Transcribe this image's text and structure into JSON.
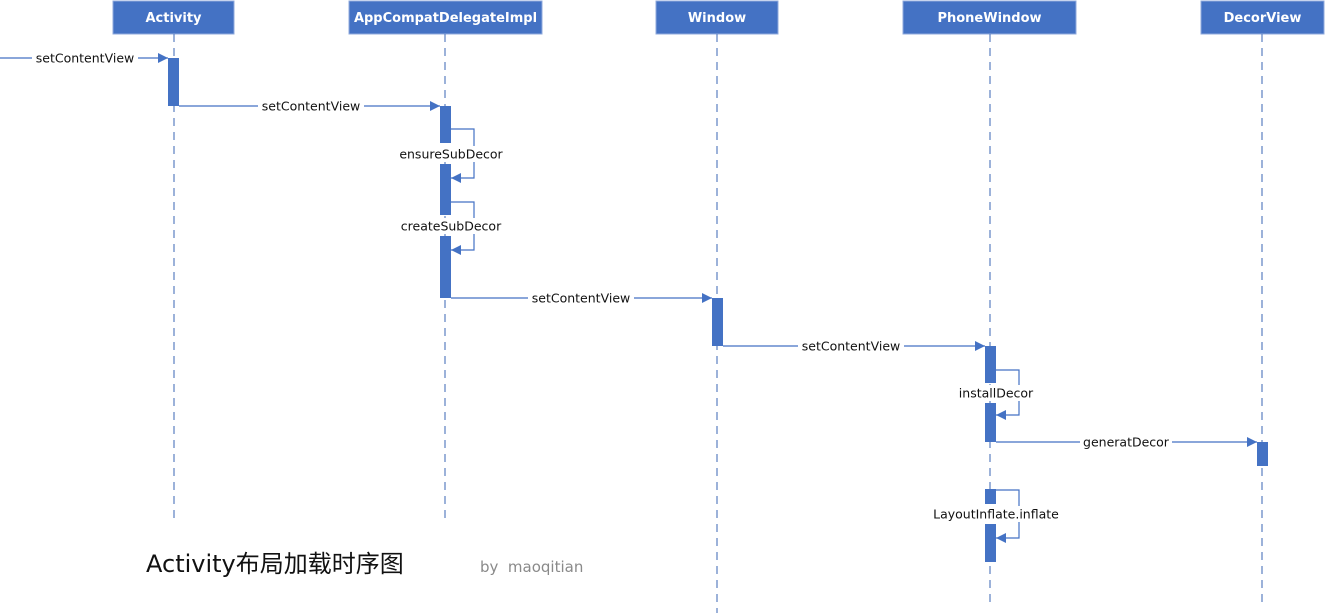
{
  "diagram": {
    "type": "sequence",
    "title": "Activity布局加载时序图",
    "author": "by  maoqitian",
    "colors": {
      "header_fill": "#4472c4",
      "header_stroke": "#8faadc",
      "activation_fill": "#4472c4",
      "message_line": "#4472c4",
      "lifeline": "#5b7fc0",
      "label_bg": "#ffffff"
    },
    "participants": [
      {
        "id": "activity",
        "label": "Activity"
      },
      {
        "id": "appcompat",
        "label": "AppCompatDelegateImpl"
      },
      {
        "id": "window",
        "label": "Window"
      },
      {
        "id": "phonewindow",
        "label": "PhoneWindow"
      },
      {
        "id": "decorview",
        "label": "DecorView"
      }
    ],
    "messages": [
      {
        "from": "external",
        "to": "activity",
        "label": "setContentView"
      },
      {
        "from": "activity",
        "to": "appcompat",
        "label": "setContentView"
      },
      {
        "from": "appcompat",
        "to": "appcompat",
        "label": "ensureSubDecor"
      },
      {
        "from": "appcompat",
        "to": "appcompat",
        "label": "createSubDecor"
      },
      {
        "from": "appcompat",
        "to": "window",
        "label": "setContentView"
      },
      {
        "from": "window",
        "to": "phonewindow",
        "label": "setContentView"
      },
      {
        "from": "phonewindow",
        "to": "phonewindow",
        "label": "installDecor"
      },
      {
        "from": "phonewindow",
        "to": "decorview",
        "label": "generatDecor"
      },
      {
        "from": "phonewindow",
        "to": "phonewindow",
        "label": "LayoutInflate.inflate"
      }
    ]
  }
}
